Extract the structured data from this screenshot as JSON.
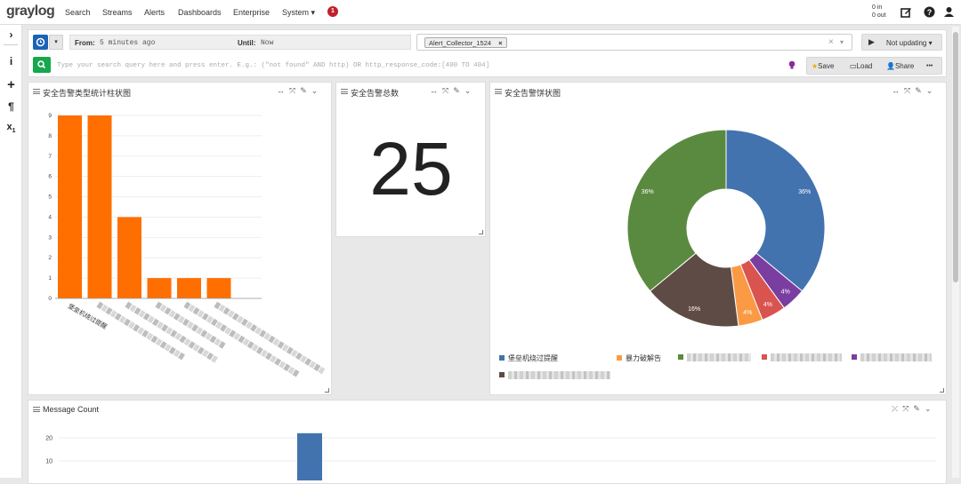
{
  "app": {
    "logo": "graylog"
  },
  "nav": {
    "items": [
      {
        "label": "Search"
      },
      {
        "label": "Streams"
      },
      {
        "label": "Alerts"
      },
      {
        "label": "Dashboards"
      },
      {
        "label": "Enterprise"
      },
      {
        "label": "System ▾"
      }
    ],
    "notification_count": "1",
    "throughput_in": "0 in",
    "throughput_out": "0 out"
  },
  "search": {
    "from_label": "From:",
    "from_value": "5 minutes ago",
    "until_label": "Until:",
    "until_value": "Now",
    "stream_tag": "Alert_Collector_1524",
    "refresh_label": "Not updating ▾",
    "query_placeholder": "Type your search query here and press enter. E.g.: (\"not found\" AND http) OR http_response_code:[400 TO 404]",
    "save_label": "Save",
    "load_label": "Load",
    "share_label": "Share",
    "more_label": "•••"
  },
  "panels": {
    "bar": {
      "title": "安全告警类型统计柱状图"
    },
    "total": {
      "title": "安全告警总数",
      "value": "25"
    },
    "pie": {
      "title": "安全告警饼状图"
    },
    "message": {
      "title": "Message Count"
    }
  },
  "chart_data": [
    {
      "type": "bar",
      "title": "安全告警类型统计柱状图",
      "categories": [
        "堡垒机绕过提醒",
        "",
        "",
        "",
        "",
        ""
      ],
      "values": [
        9,
        9,
        4,
        1,
        1,
        1
      ],
      "ylim": [
        0,
        9
      ],
      "yticks": [
        "0",
        "1",
        "2",
        "3",
        "4",
        "5",
        "6",
        "7",
        "8",
        "9"
      ],
      "color": "#ff6f00",
      "grid": true
    },
    {
      "type": "pie",
      "title": "安全告警饼状图",
      "slices": [
        {
          "label": "堡垒机绕过提醒",
          "value": 36,
          "text": "36%",
          "color": "#4373ae"
        },
        {
          "label": "",
          "value": 4,
          "text": "4%",
          "color": "#7a3ea1"
        },
        {
          "label": "",
          "value": 4,
          "text": "4%",
          "color": "#d9534f"
        },
        {
          "label": "暴力破解告",
          "value": 4,
          "text": "4%",
          "color": "#fb9a45"
        },
        {
          "label": "",
          "value": 16,
          "text": "16%",
          "color": "#5f4b45"
        },
        {
          "label": "",
          "value": 36,
          "text": "36%",
          "color": "#5a8a3f"
        }
      ],
      "legend": "bottom"
    },
    {
      "type": "bar",
      "title": "Message Count",
      "yticks": [
        "10",
        "20"
      ],
      "values": [
        22
      ],
      "color": "#4373ae"
    }
  ]
}
